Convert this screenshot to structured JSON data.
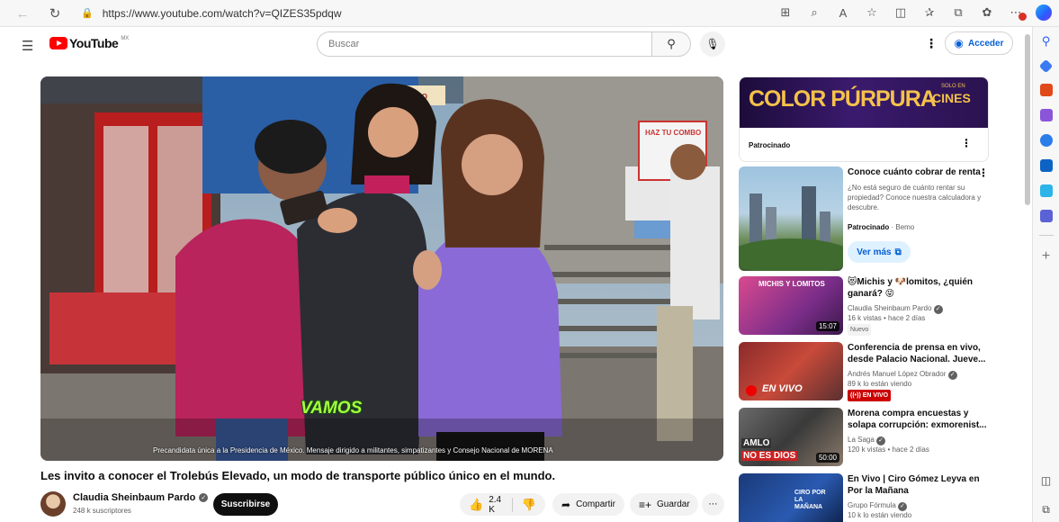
{
  "browser": {
    "url": "https://www.youtube.com/watch?v=QIZES35pdqw",
    "icons": [
      "back-icon",
      "reload-icon",
      "lock-icon"
    ]
  },
  "header": {
    "logo_text": "YouTube",
    "country_code": "MX",
    "search_placeholder": "Buscar",
    "signin_label": "Acceder"
  },
  "video": {
    "caption_word": "VAMOS",
    "caption_sub": "Precandidata única a la Presidencia de México. Mensaje dirigido a militantes, simpatizantes y Consejo Nacional de MORENA",
    "title": "Les invito a conocer el Trolebús Elevado, un modo de transporte público único en el mundo.",
    "channel": "Claudia Sheinbaum Pardo",
    "subscribers": "248 k suscriptores",
    "subscribe_label": "Suscribirse",
    "likes": "2.4 K",
    "share_label": "Compartir",
    "save_label": "Guardar",
    "scene_sign": "ELADO",
    "scene_board": "HAZ TU COMBO"
  },
  "sidebar": {
    "ad": {
      "banner_title": "COLOR PÚRPURA",
      "banner_side": "CINES",
      "banner_small": "SOLO EN",
      "label": "Patrocinado"
    },
    "sponsored": {
      "title": "Conoce cuánto cobrar de renta",
      "desc": "¿No está seguro de cuánto rentar su propiedad? Conoce nuestra calculadora y descubre.",
      "sponsor_label": "Patrocinado",
      "sponsor": "· Bemo",
      "button": "Ver más"
    },
    "items": [
      {
        "title": "😻Michis y 🐶lomitos, ¿quién ganará? 😝",
        "channel": "Claudia Sheinbaum Pardo",
        "meta": "16 k vistas  • hace 2 días",
        "badge": "Nuevo",
        "duration": "15:07",
        "thumb_text": "MICHIS Y LOMITOS"
      },
      {
        "title": "Conferencia de prensa en vivo, desde Palacio Nacional. Jueve...",
        "channel": "Andrés Manuel López Obrador",
        "meta": "89 k lo están viendo",
        "badge": "EN VIVO",
        "thumb_text": "EN VIVO"
      },
      {
        "title": "Morena compra encuestas y solapa corrupción: exmorenist...",
        "channel": "La Saga",
        "meta": "120 k vistas  • hace 2 días",
        "duration": "50:00",
        "thumb_text_1": "AMLO",
        "thumb_text_2": "NO ES DIOS"
      },
      {
        "title": "En Vivo | Ciro Gómez Leyva en Por la Mañana",
        "channel": "Grupo Fórmula",
        "meta": "10 k lo están viendo",
        "thumb_text": "CIRO POR LA MAÑANA"
      }
    ]
  }
}
